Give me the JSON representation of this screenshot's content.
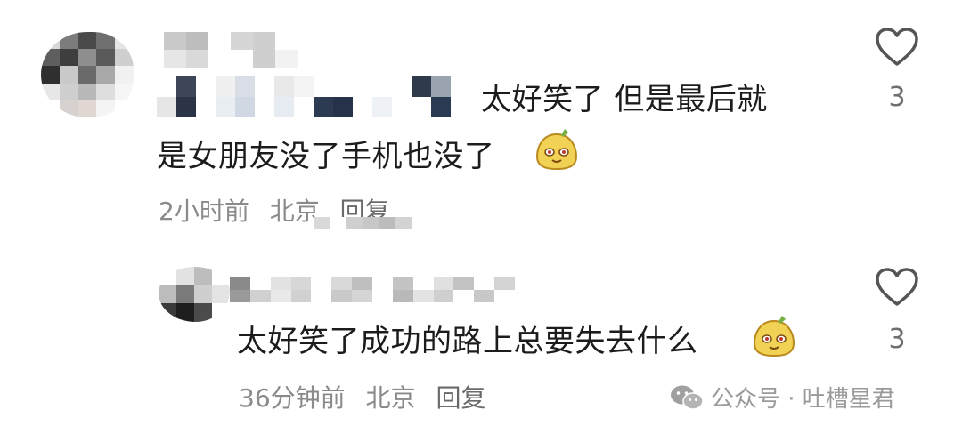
{
  "comments": [
    {
      "text_line1": "太好笑了 但是最后就",
      "text_line2": "是女朋友没了手机也没了",
      "time": "2小时前",
      "location": "北京",
      "reply_label": "回复",
      "likes": "3"
    },
    {
      "text_line1": "太好笑了成功的路上总要失去什么",
      "time": "36分钟前",
      "location": "北京",
      "reply_label": "回复",
      "likes": "3"
    }
  ],
  "watermark": {
    "text": "公众号 · 吐槽星君",
    "icon": "wechat-icon"
  },
  "colors": {
    "text": "#1c1c1c",
    "meta": "#8a8a8a",
    "heart_outline": "#555555",
    "emoji_fill": "#f2d255"
  }
}
